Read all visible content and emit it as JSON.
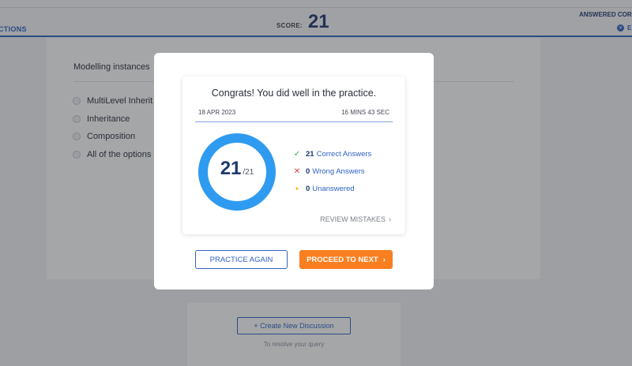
{
  "header": {
    "sections_label": "CTIONS",
    "score_label": "SCORE:",
    "score_value": "21",
    "answered_label": "ANSWERED CORR",
    "end_label": "E",
    "end_icon": "circle-x-icon"
  },
  "question": {
    "title": "Modelling instances",
    "options": [
      "MultiLevel Inherit",
      "Inheritance",
      "Composition",
      "All of the options"
    ]
  },
  "discussion": {
    "button_label": "+ Create New Discussion",
    "hint": "To resolve your query"
  },
  "modal": {
    "heading": "Congrats! You did well in the practice.",
    "date": "18 APR 2023",
    "duration": "16 MINS 43 SEC",
    "score": "21",
    "total": "/21",
    "score_fraction": 1.0,
    "stats": [
      {
        "icon": "check-icon",
        "glyph": "✓",
        "color": "#2eaa5b",
        "value": "21",
        "label": "Correct Answers"
      },
      {
        "icon": "cross-icon",
        "glyph": "✕",
        "color": "#e03b3b",
        "value": "0",
        "label": "Wrong Answers"
      },
      {
        "icon": "dot-icon",
        "glyph": "●",
        "color": "#f4b400",
        "value": "0",
        "label": "Unanswered"
      }
    ],
    "review_label": "REVIEW MISTAKES",
    "practice_again_label": "PRACTICE AGAIN",
    "proceed_label": "PROCEED TO NEXT"
  },
  "colors": {
    "accent": "#2f62c4",
    "ring": "#2e9bf0",
    "cta": "#f97f20"
  }
}
